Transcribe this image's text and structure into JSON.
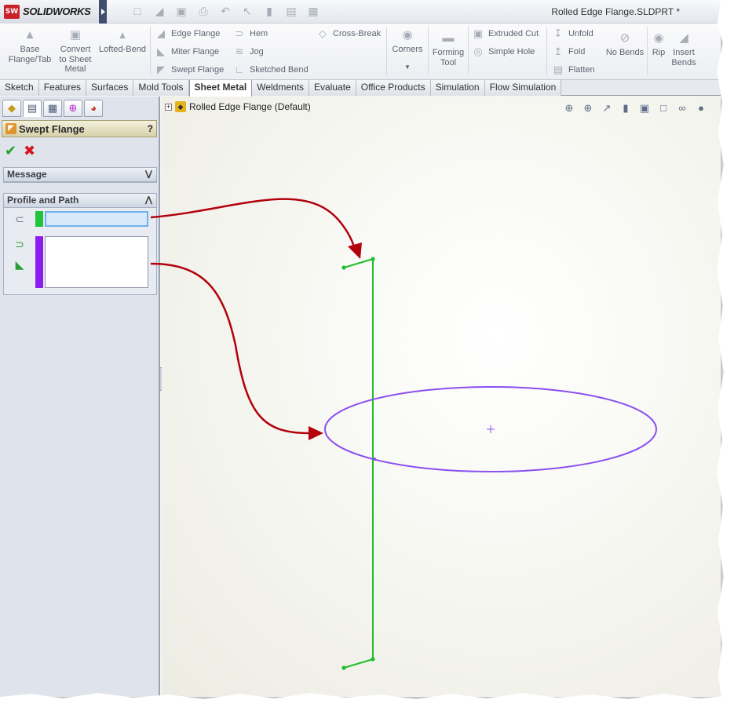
{
  "app": {
    "logo_badge": "SW",
    "logo_name": "SOLIDWORKS",
    "document_title": "Rolled Edge Flange.SLDPRT *"
  },
  "ribbon": {
    "base_flange": "Base Flange/Tab",
    "convert": "Convert to Sheet Metal",
    "lofted_bend": "Lofted-Bend",
    "edge_flange": "Edge Flange",
    "miter_flange": "Miter Flange",
    "swept_flange": "Swept Flange",
    "hem": "Hem",
    "jog": "Jog",
    "sketched_bend": "Sketched Bend",
    "cross_break": "Cross-Break",
    "corners": "Corners",
    "forming_tool": "Forming Tool",
    "extruded_cut": "Extruded Cut",
    "simple_hole": "Simple Hole",
    "unfold": "Unfold",
    "fold": "Fold",
    "flatten": "Flatten",
    "no_bends": "No Bends",
    "rip": "Rip",
    "insert_bends": "Insert Bends"
  },
  "tabs": [
    "Sketch",
    "Features",
    "Surfaces",
    "Mold Tools",
    "Sheet Metal",
    "Weldments",
    "Evaluate",
    "Office Products",
    "Simulation",
    "Flow Simulation"
  ],
  "active_tab": "Sheet Metal",
  "property_manager": {
    "title": "Swept Flange",
    "help": "?",
    "message_group": "Message",
    "profile_group": "Profile and Path",
    "profile_color": "#21c43a",
    "path_color": "#8c1cf0"
  },
  "graphics": {
    "tree_label": "Rolled Edge Flange  (Default)",
    "profile_line_color": "#1fbf2b",
    "path_ellipse_color": "#8a4ff0",
    "callout_arrow_color": "#b3000c"
  }
}
